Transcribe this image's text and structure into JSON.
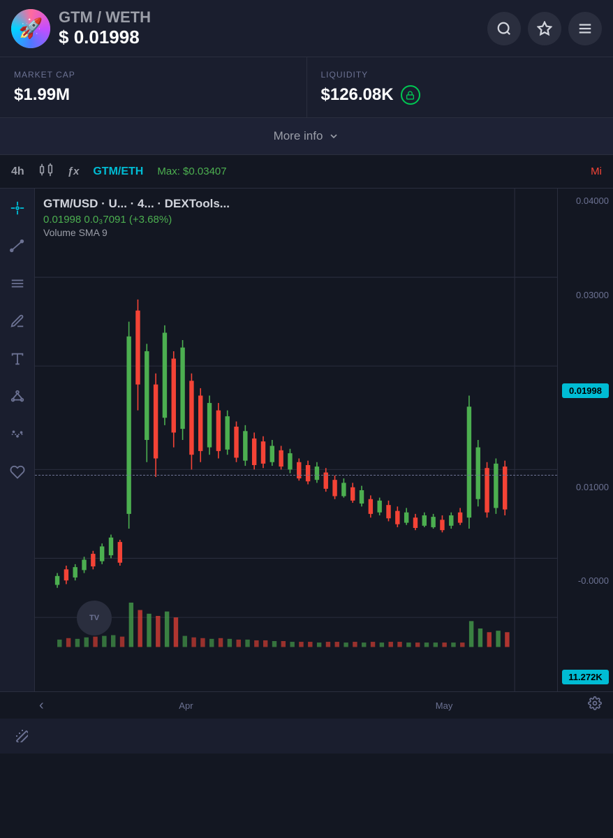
{
  "header": {
    "pair": "GTM",
    "separator": " / ",
    "quote": "WETH",
    "price_prefix": "$ ",
    "price": "0.01998",
    "search_label": "Search",
    "favorite_label": "Favorite",
    "menu_label": "Menu"
  },
  "stats": {
    "market_cap": {
      "label": "MARKET CAP",
      "value": "$1.99M"
    },
    "liquidity": {
      "label": "LIQUIDITY",
      "value": "$126.08K",
      "lock": true
    }
  },
  "more_info": {
    "label": "More info",
    "chevron": "∨"
  },
  "chart_toolbar": {
    "timeframe": "4h",
    "pair_label": "GTM/ETH",
    "max_label": "Max: $0.03407",
    "min_label": "Mi"
  },
  "chart": {
    "pair_name": "GTM/USD · U... · 4... · DEXTools...",
    "price": "0.01998",
    "price_secondary": "0.0₃7091",
    "change": "(+3.68%)",
    "volume_sma": "Volume SMA 9",
    "current_price_badge": "0.01998",
    "volume_badge": "11.272K",
    "price_levels": [
      "0.04000",
      "0.03000",
      "0.01000",
      "-0.0000"
    ],
    "current_price_line": "0.01998"
  },
  "time_labels": {
    "left": "Apr",
    "right": "May"
  },
  "tools": [
    {
      "name": "crosshair",
      "icon": "✛"
    },
    {
      "name": "line",
      "icon": "╱"
    },
    {
      "name": "horizontal-lines",
      "icon": "≡"
    },
    {
      "name": "pen",
      "icon": "✒"
    },
    {
      "name": "text",
      "icon": "T"
    },
    {
      "name": "network",
      "icon": "⬡"
    },
    {
      "name": "dots-line",
      "icon": "⋯"
    },
    {
      "name": "heart",
      "icon": "♡"
    }
  ]
}
